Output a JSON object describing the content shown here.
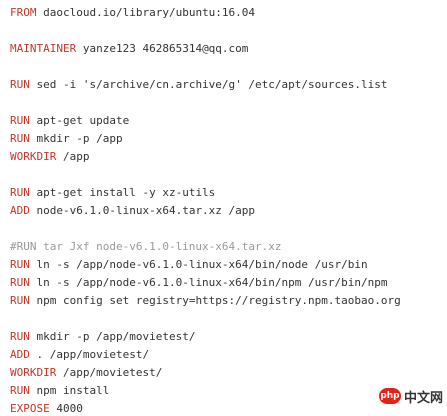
{
  "code_lines": [
    {
      "keyword": "FROM",
      "text": " daocloud.io/library/ubuntu:16.04",
      "comment": false
    },
    {
      "keyword": "",
      "text": "",
      "comment": false
    },
    {
      "keyword": "MAINTAINER",
      "text": " yanze123 462865314@qq.com",
      "comment": false
    },
    {
      "keyword": "",
      "text": "",
      "comment": false
    },
    {
      "keyword": "RUN",
      "text": " sed -i 's/archive/cn.archive/g' /etc/apt/sources.list",
      "comment": false
    },
    {
      "keyword": "",
      "text": "",
      "comment": false
    },
    {
      "keyword": "RUN",
      "text": " apt-get update",
      "comment": false
    },
    {
      "keyword": "RUN",
      "text": " mkdir -p /app",
      "comment": false
    },
    {
      "keyword": "WORKDIR",
      "text": " /app",
      "comment": false
    },
    {
      "keyword": "",
      "text": "",
      "comment": false
    },
    {
      "keyword": "RUN",
      "text": " apt-get install -y xz-utils",
      "comment": false
    },
    {
      "keyword": "ADD",
      "text": " node-v6.1.0-linux-x64.tar.xz /app",
      "comment": false
    },
    {
      "keyword": "",
      "text": "",
      "comment": false
    },
    {
      "keyword": "",
      "text": "#RUN tar Jxf node-v6.1.0-linux-x64.tar.xz",
      "comment": true
    },
    {
      "keyword": "RUN",
      "text": " ln -s /app/node-v6.1.0-linux-x64/bin/node /usr/bin",
      "comment": false
    },
    {
      "keyword": "RUN",
      "text": " ln -s /app/node-v6.1.0-linux-x64/bin/npm /usr/bin/npm",
      "comment": false
    },
    {
      "keyword": "RUN",
      "text": " npm config set registry=https://registry.npm.taobao.org",
      "comment": false
    },
    {
      "keyword": "",
      "text": "",
      "comment": false
    },
    {
      "keyword": "RUN",
      "text": " mkdir -p /app/movietest/",
      "comment": false
    },
    {
      "keyword": "ADD",
      "text": " . /app/movietest/",
      "comment": false
    },
    {
      "keyword": "WORKDIR",
      "text": " /app/movietest/",
      "comment": false
    },
    {
      "keyword": "RUN",
      "text": " npm install",
      "comment": false
    },
    {
      "keyword": "EXPOSE",
      "text": " 4000",
      "comment": false
    }
  ],
  "watermark": {
    "logo_text": "php",
    "site_text": "中文网"
  },
  "colors": {
    "keyword": "#c0392b",
    "comment": "#999999",
    "text": "#333333",
    "background": "#ffffff"
  }
}
